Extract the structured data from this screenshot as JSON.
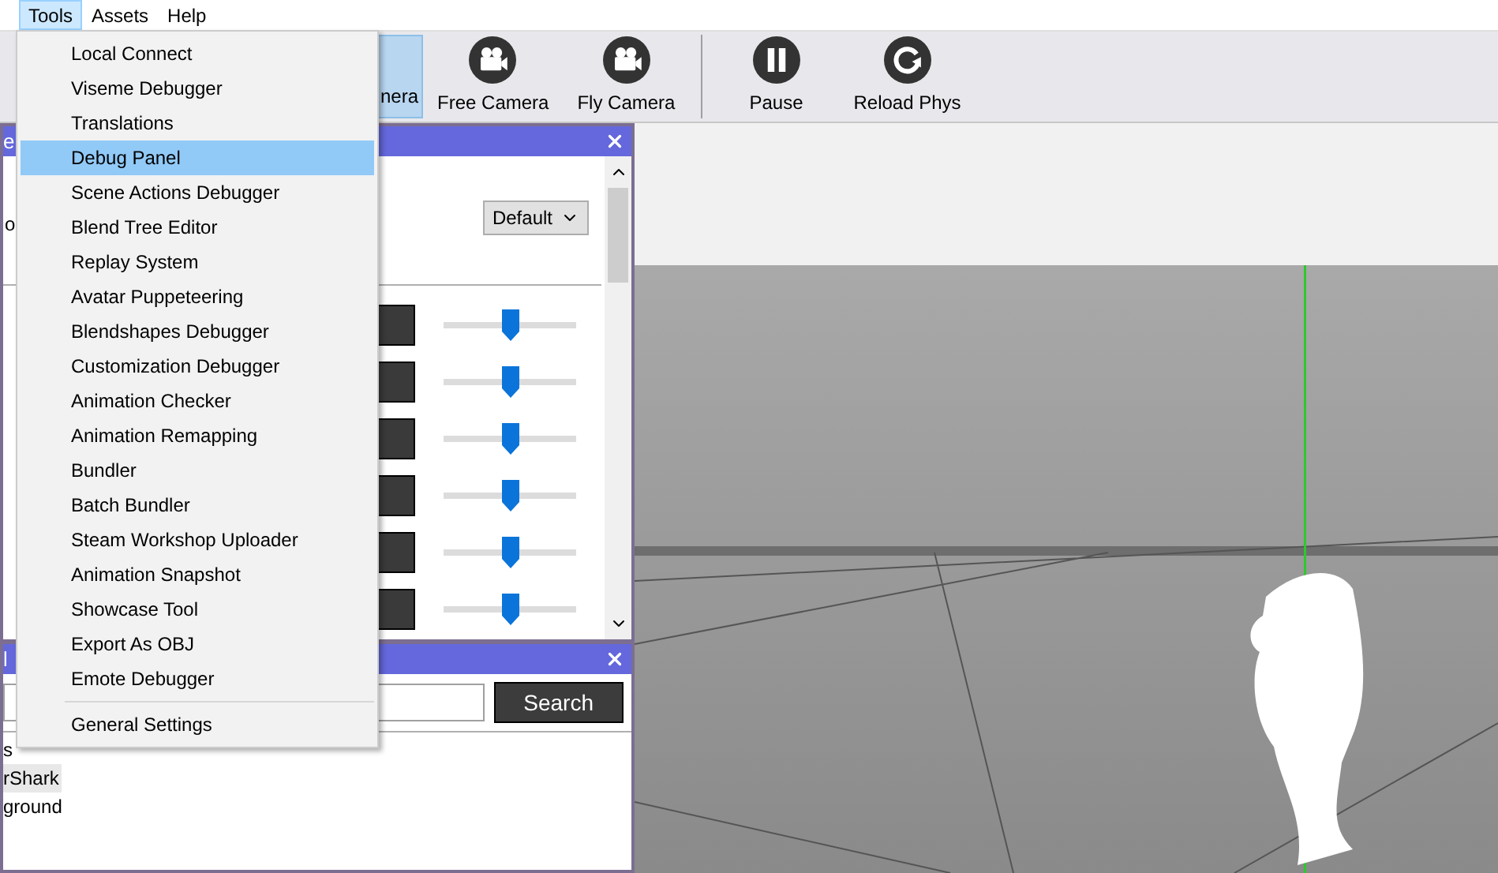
{
  "menu_bar": {
    "items": [
      {
        "label": "Tools",
        "selected": true
      },
      {
        "label": "Assets",
        "selected": false
      },
      {
        "label": "Help",
        "selected": false
      }
    ]
  },
  "toolbar": {
    "items": [
      {
        "kind": "covered",
        "label": "nera",
        "selected": true
      },
      {
        "kind": "camera",
        "label": "Free Camera",
        "selected": false
      },
      {
        "kind": "camera",
        "label": "Fly Camera",
        "selected": false
      },
      {
        "kind": "separator"
      },
      {
        "kind": "pause",
        "label": "Pause",
        "selected": false
      },
      {
        "kind": "reload",
        "label": "Reload Phys",
        "selected": false
      }
    ]
  },
  "tools_menu": {
    "items": [
      {
        "kind": "item",
        "label": "Local Connect",
        "selected": false
      },
      {
        "kind": "item",
        "label": "Viseme Debugger",
        "selected": false
      },
      {
        "kind": "item",
        "label": "Translations",
        "selected": false
      },
      {
        "kind": "item",
        "label": "Debug Panel",
        "selected": true
      },
      {
        "kind": "item",
        "label": "Scene Actions Debugger",
        "selected": false
      },
      {
        "kind": "item",
        "label": "Blend Tree Editor",
        "selected": false
      },
      {
        "kind": "item",
        "label": "Replay System",
        "selected": false
      },
      {
        "kind": "item",
        "label": "Avatar Puppeteering",
        "selected": false
      },
      {
        "kind": "item",
        "label": "Blendshapes Debugger",
        "selected": false
      },
      {
        "kind": "item",
        "label": "Customization Debugger",
        "selected": false
      },
      {
        "kind": "item",
        "label": "Animation Checker",
        "selected": false
      },
      {
        "kind": "item",
        "label": "Animation Remapping",
        "selected": false
      },
      {
        "kind": "item",
        "label": "Bundler",
        "selected": false
      },
      {
        "kind": "item",
        "label": "Batch Bundler",
        "selected": false
      },
      {
        "kind": "item",
        "label": "Steam Workshop Uploader",
        "selected": false
      },
      {
        "kind": "item",
        "label": "Animation Snapshot",
        "selected": false
      },
      {
        "kind": "item",
        "label": "Showcase Tool",
        "selected": false
      },
      {
        "kind": "item",
        "label": "Export As OBJ",
        "selected": false
      },
      {
        "kind": "item",
        "label": "Emote Debugger",
        "selected": false
      },
      {
        "kind": "separator"
      },
      {
        "kind": "item",
        "label": "General Settings",
        "selected": false
      }
    ]
  },
  "panel_1": {
    "title": "e",
    "side_text": "o",
    "preset": "Default",
    "sliders": [
      {
        "level": 0.5
      },
      {
        "level": 0.5
      },
      {
        "level": 0.5
      },
      {
        "level": 0.5
      },
      {
        "level": 0.5
      },
      {
        "level": 0.5
      }
    ]
  },
  "panel_2": {
    "title": "l",
    "search_button": "Search",
    "items": [
      {
        "label": "s",
        "selected": false
      },
      {
        "label": "rShark",
        "selected": true
      },
      {
        "label": "ground",
        "selected": false
      }
    ]
  }
}
